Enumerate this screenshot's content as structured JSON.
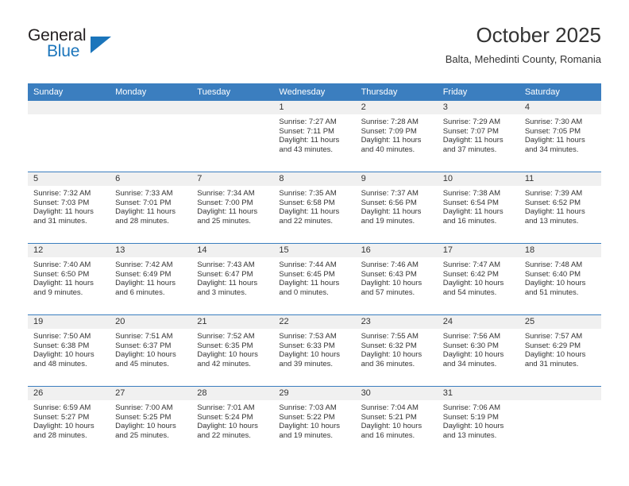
{
  "brand": {
    "name_top": "General",
    "name_bottom": "Blue",
    "accent_color": "#1b75bb"
  },
  "header": {
    "title": "October 2025",
    "subtitle": "Balta, Mehedinti County, Romania"
  },
  "theme": {
    "header_row_bg": "#3b7ebf",
    "daynum_band_bg": "#f0f0f0",
    "text_color": "#333333"
  },
  "weekday_headers": [
    "Sunday",
    "Monday",
    "Tuesday",
    "Wednesday",
    "Thursday",
    "Friday",
    "Saturday"
  ],
  "weeks": [
    [
      {
        "empty": true
      },
      {
        "empty": true
      },
      {
        "empty": true
      },
      {
        "day": "1",
        "sunrise": "Sunrise: 7:27 AM",
        "sunset": "Sunset: 7:11 PM",
        "daylight_line1": "Daylight: 11 hours",
        "daylight_line2": "and 43 minutes."
      },
      {
        "day": "2",
        "sunrise": "Sunrise: 7:28 AM",
        "sunset": "Sunset: 7:09 PM",
        "daylight_line1": "Daylight: 11 hours",
        "daylight_line2": "and 40 minutes."
      },
      {
        "day": "3",
        "sunrise": "Sunrise: 7:29 AM",
        "sunset": "Sunset: 7:07 PM",
        "daylight_line1": "Daylight: 11 hours",
        "daylight_line2": "and 37 minutes."
      },
      {
        "day": "4",
        "sunrise": "Sunrise: 7:30 AM",
        "sunset": "Sunset: 7:05 PM",
        "daylight_line1": "Daylight: 11 hours",
        "daylight_line2": "and 34 minutes."
      }
    ],
    [
      {
        "day": "5",
        "sunrise": "Sunrise: 7:32 AM",
        "sunset": "Sunset: 7:03 PM",
        "daylight_line1": "Daylight: 11 hours",
        "daylight_line2": "and 31 minutes."
      },
      {
        "day": "6",
        "sunrise": "Sunrise: 7:33 AM",
        "sunset": "Sunset: 7:01 PM",
        "daylight_line1": "Daylight: 11 hours",
        "daylight_line2": "and 28 minutes."
      },
      {
        "day": "7",
        "sunrise": "Sunrise: 7:34 AM",
        "sunset": "Sunset: 7:00 PM",
        "daylight_line1": "Daylight: 11 hours",
        "daylight_line2": "and 25 minutes."
      },
      {
        "day": "8",
        "sunrise": "Sunrise: 7:35 AM",
        "sunset": "Sunset: 6:58 PM",
        "daylight_line1": "Daylight: 11 hours",
        "daylight_line2": "and 22 minutes."
      },
      {
        "day": "9",
        "sunrise": "Sunrise: 7:37 AM",
        "sunset": "Sunset: 6:56 PM",
        "daylight_line1": "Daylight: 11 hours",
        "daylight_line2": "and 19 minutes."
      },
      {
        "day": "10",
        "sunrise": "Sunrise: 7:38 AM",
        "sunset": "Sunset: 6:54 PM",
        "daylight_line1": "Daylight: 11 hours",
        "daylight_line2": "and 16 minutes."
      },
      {
        "day": "11",
        "sunrise": "Sunrise: 7:39 AM",
        "sunset": "Sunset: 6:52 PM",
        "daylight_line1": "Daylight: 11 hours",
        "daylight_line2": "and 13 minutes."
      }
    ],
    [
      {
        "day": "12",
        "sunrise": "Sunrise: 7:40 AM",
        "sunset": "Sunset: 6:50 PM",
        "daylight_line1": "Daylight: 11 hours",
        "daylight_line2": "and 9 minutes."
      },
      {
        "day": "13",
        "sunrise": "Sunrise: 7:42 AM",
        "sunset": "Sunset: 6:49 PM",
        "daylight_line1": "Daylight: 11 hours",
        "daylight_line2": "and 6 minutes."
      },
      {
        "day": "14",
        "sunrise": "Sunrise: 7:43 AM",
        "sunset": "Sunset: 6:47 PM",
        "daylight_line1": "Daylight: 11 hours",
        "daylight_line2": "and 3 minutes."
      },
      {
        "day": "15",
        "sunrise": "Sunrise: 7:44 AM",
        "sunset": "Sunset: 6:45 PM",
        "daylight_line1": "Daylight: 11 hours",
        "daylight_line2": "and 0 minutes."
      },
      {
        "day": "16",
        "sunrise": "Sunrise: 7:46 AM",
        "sunset": "Sunset: 6:43 PM",
        "daylight_line1": "Daylight: 10 hours",
        "daylight_line2": "and 57 minutes."
      },
      {
        "day": "17",
        "sunrise": "Sunrise: 7:47 AM",
        "sunset": "Sunset: 6:42 PM",
        "daylight_line1": "Daylight: 10 hours",
        "daylight_line2": "and 54 minutes."
      },
      {
        "day": "18",
        "sunrise": "Sunrise: 7:48 AM",
        "sunset": "Sunset: 6:40 PM",
        "daylight_line1": "Daylight: 10 hours",
        "daylight_line2": "and 51 minutes."
      }
    ],
    [
      {
        "day": "19",
        "sunrise": "Sunrise: 7:50 AM",
        "sunset": "Sunset: 6:38 PM",
        "daylight_line1": "Daylight: 10 hours",
        "daylight_line2": "and 48 minutes."
      },
      {
        "day": "20",
        "sunrise": "Sunrise: 7:51 AM",
        "sunset": "Sunset: 6:37 PM",
        "daylight_line1": "Daylight: 10 hours",
        "daylight_line2": "and 45 minutes."
      },
      {
        "day": "21",
        "sunrise": "Sunrise: 7:52 AM",
        "sunset": "Sunset: 6:35 PM",
        "daylight_line1": "Daylight: 10 hours",
        "daylight_line2": "and 42 minutes."
      },
      {
        "day": "22",
        "sunrise": "Sunrise: 7:53 AM",
        "sunset": "Sunset: 6:33 PM",
        "daylight_line1": "Daylight: 10 hours",
        "daylight_line2": "and 39 minutes."
      },
      {
        "day": "23",
        "sunrise": "Sunrise: 7:55 AM",
        "sunset": "Sunset: 6:32 PM",
        "daylight_line1": "Daylight: 10 hours",
        "daylight_line2": "and 36 minutes."
      },
      {
        "day": "24",
        "sunrise": "Sunrise: 7:56 AM",
        "sunset": "Sunset: 6:30 PM",
        "daylight_line1": "Daylight: 10 hours",
        "daylight_line2": "and 34 minutes."
      },
      {
        "day": "25",
        "sunrise": "Sunrise: 7:57 AM",
        "sunset": "Sunset: 6:29 PM",
        "daylight_line1": "Daylight: 10 hours",
        "daylight_line2": "and 31 minutes."
      }
    ],
    [
      {
        "day": "26",
        "sunrise": "Sunrise: 6:59 AM",
        "sunset": "Sunset: 5:27 PM",
        "daylight_line1": "Daylight: 10 hours",
        "daylight_line2": "and 28 minutes."
      },
      {
        "day": "27",
        "sunrise": "Sunrise: 7:00 AM",
        "sunset": "Sunset: 5:25 PM",
        "daylight_line1": "Daylight: 10 hours",
        "daylight_line2": "and 25 minutes."
      },
      {
        "day": "28",
        "sunrise": "Sunrise: 7:01 AM",
        "sunset": "Sunset: 5:24 PM",
        "daylight_line1": "Daylight: 10 hours",
        "daylight_line2": "and 22 minutes."
      },
      {
        "day": "29",
        "sunrise": "Sunrise: 7:03 AM",
        "sunset": "Sunset: 5:22 PM",
        "daylight_line1": "Daylight: 10 hours",
        "daylight_line2": "and 19 minutes."
      },
      {
        "day": "30",
        "sunrise": "Sunrise: 7:04 AM",
        "sunset": "Sunset: 5:21 PM",
        "daylight_line1": "Daylight: 10 hours",
        "daylight_line2": "and 16 minutes."
      },
      {
        "day": "31",
        "sunrise": "Sunrise: 7:06 AM",
        "sunset": "Sunset: 5:19 PM",
        "daylight_line1": "Daylight: 10 hours",
        "daylight_line2": "and 13 minutes."
      },
      {
        "empty": true
      }
    ]
  ]
}
